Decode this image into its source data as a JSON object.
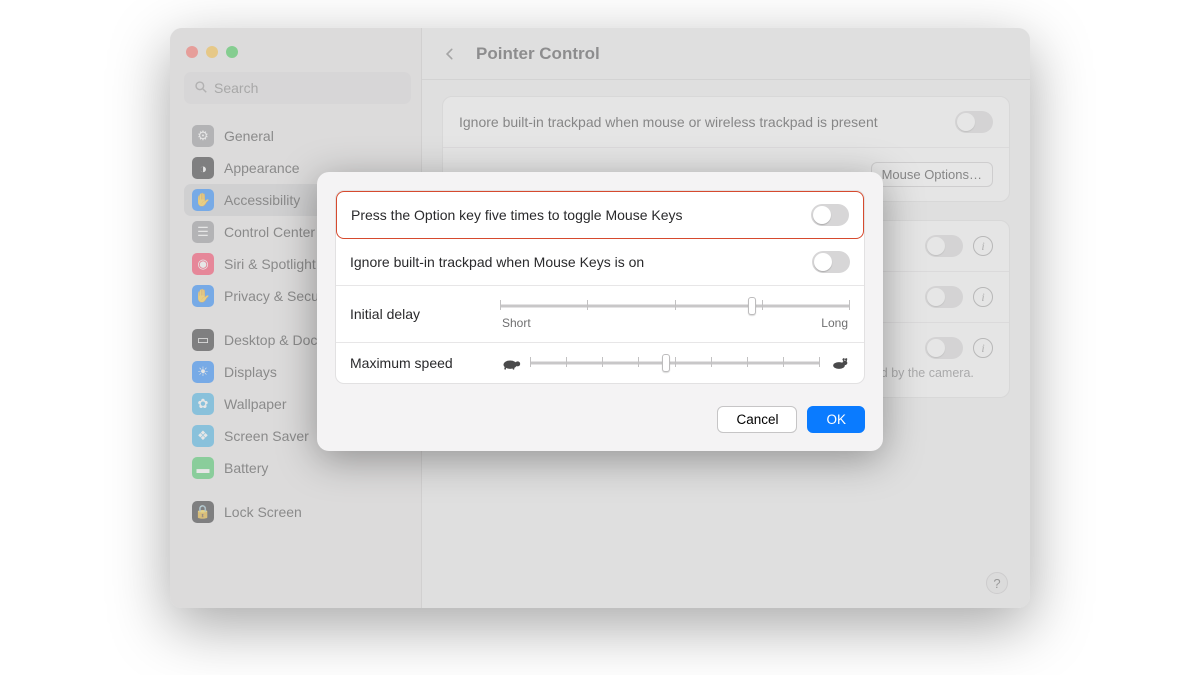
{
  "window": {
    "title": "Pointer Control"
  },
  "search": {
    "placeholder": "Search"
  },
  "sidebar": {
    "items": [
      {
        "label": "General",
        "color": "#8e8e93",
        "glyph": "⚙"
      },
      {
        "label": "Appearance",
        "color": "#1c1c1e",
        "glyph": "◑"
      },
      {
        "label": "Accessibility",
        "color": "#0a7bff",
        "glyph": "✋",
        "selected": true
      },
      {
        "label": "Control Center",
        "color": "#8e8e93",
        "glyph": "☰"
      },
      {
        "label": "Siri & Spotlight",
        "color": "#ff2d55",
        "glyph": "◉"
      },
      {
        "label": "Privacy & Security",
        "color": "#0a7bff",
        "glyph": "✋"
      },
      {
        "label": "Desktop & Dock",
        "color": "#1c1c1e",
        "glyph": "▭",
        "gap": true
      },
      {
        "label": "Displays",
        "color": "#0a7bff",
        "glyph": "☀"
      },
      {
        "label": "Wallpaper",
        "color": "#32ade6",
        "glyph": "✿"
      },
      {
        "label": "Screen Saver",
        "color": "#32ade6",
        "glyph": "❖"
      },
      {
        "label": "Battery",
        "color": "#34c759",
        "glyph": "▬"
      },
      {
        "label": "Lock Screen",
        "color": "#1c1c1e",
        "glyph": "🔒",
        "gap": true
      }
    ]
  },
  "main": {
    "ignore_trackpad_label": "Ignore built-in trackpad when mouse or wireless trackpad is present",
    "mouse_options_label": "Mouse Options…",
    "toggle_row1_label": "",
    "head_pointer_sub": "Allows the pointer to be controlled using the movement of your head captured by the camera.",
    "help_glyph": "?"
  },
  "sheet": {
    "row1": "Press the Option key five times to toggle Mouse Keys",
    "row2": "Ignore built-in trackpad when Mouse Keys is on",
    "row3_label": "Initial delay",
    "row3_min": "Short",
    "row3_max": "Long",
    "row3_value_pct": 72,
    "row4_label": "Maximum speed",
    "row4_value_pct": 47,
    "cancel": "Cancel",
    "ok": "OK"
  }
}
